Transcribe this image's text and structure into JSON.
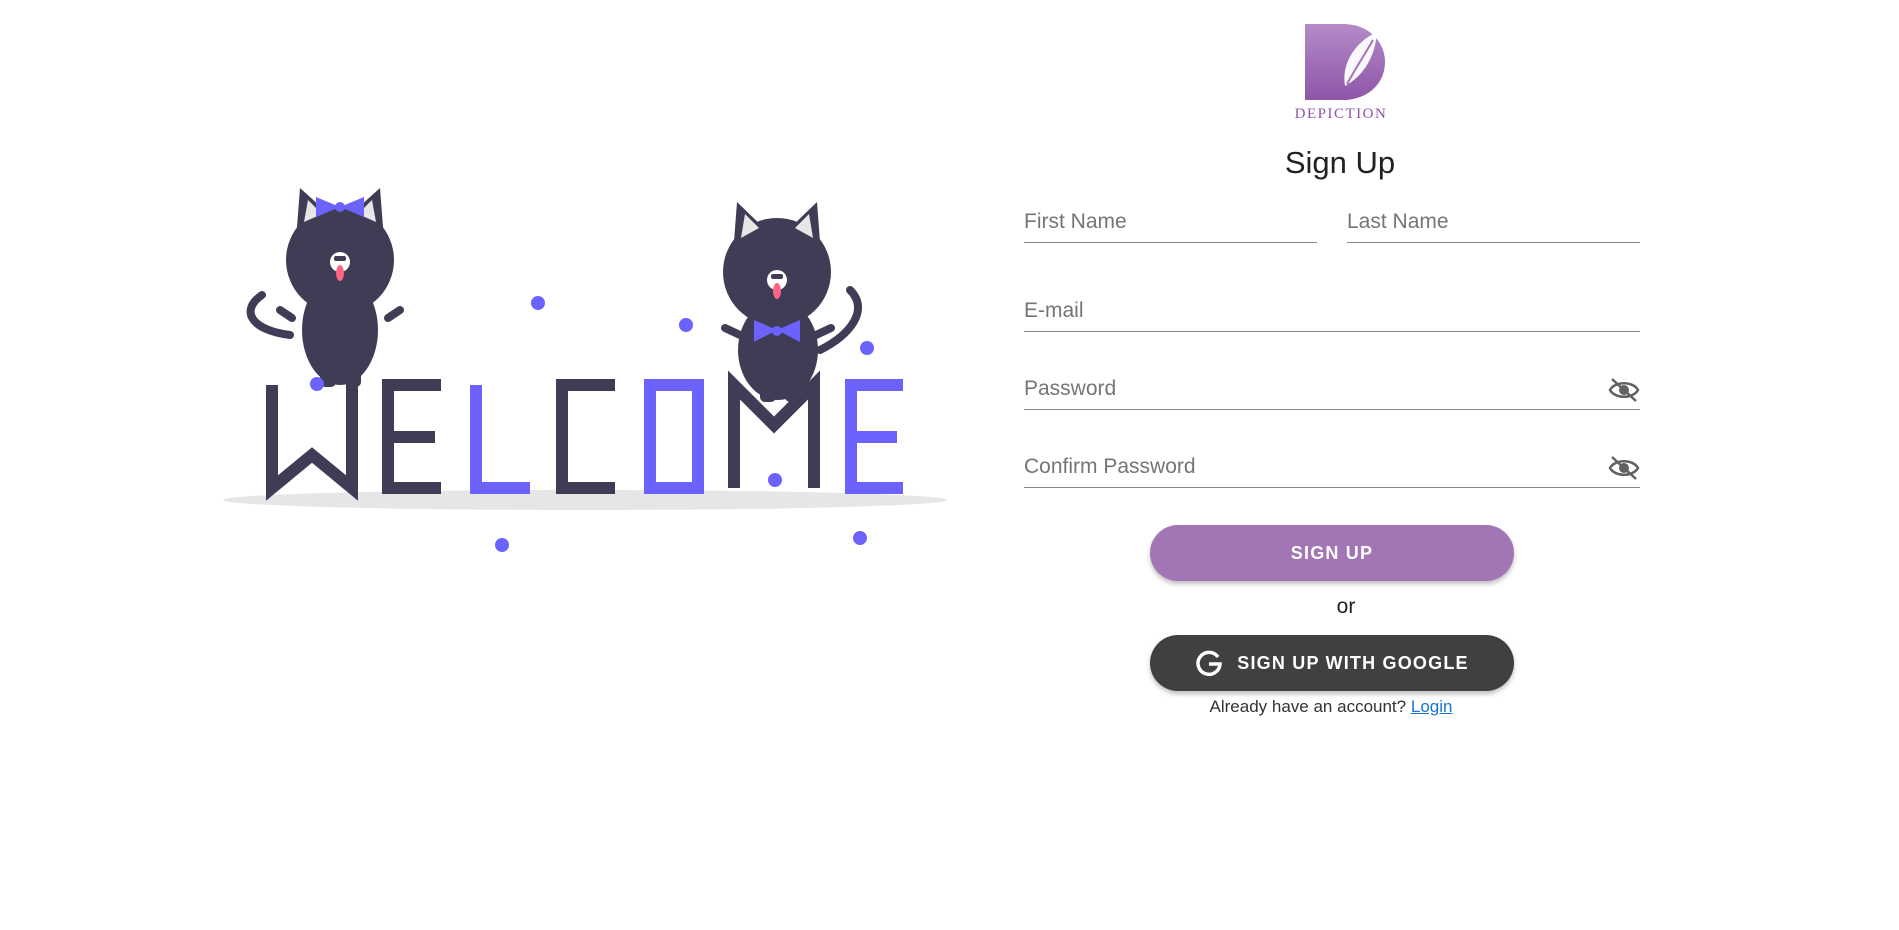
{
  "logo": {
    "text": "DEPICTION",
    "color": "#9b59b6"
  },
  "form": {
    "title": "Sign Up",
    "first_name": {
      "label": "First Name",
      "value": ""
    },
    "last_name": {
      "label": "Last Name",
      "value": ""
    },
    "email": {
      "label": "E-mail",
      "value": ""
    },
    "password": {
      "label": "Password",
      "value": "",
      "toggle_icon": "eye-off-icon"
    },
    "confirm_password": {
      "label": "Confirm Password",
      "value": "",
      "toggle_icon": "eye-off-icon"
    },
    "signup_button": "SIGN UP",
    "or_text": "or",
    "google_button": "SIGN UP WITH GOOGLE",
    "google_icon": "google-g-icon",
    "footer_text": "Already have an account?",
    "login_link": "Login"
  },
  "illustration": {
    "word": "WELCOME",
    "colors": {
      "dark": "#3f3d56",
      "accent": "#6c63ff",
      "tongue": "#ff6584",
      "shadow": "#e6e6e6"
    }
  },
  "colors": {
    "signup_button": "#a275b5",
    "google_button": "#404040",
    "link": "#1976d2"
  }
}
